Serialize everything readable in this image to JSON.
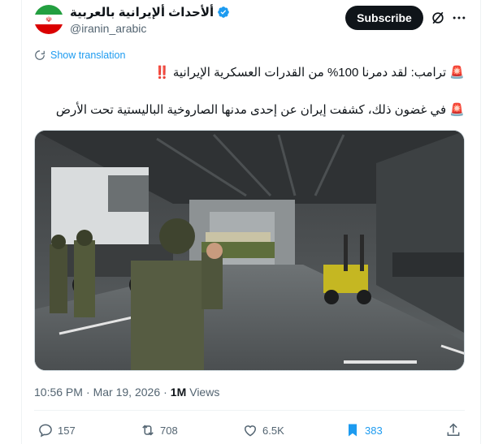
{
  "account": {
    "display_name": "ألأحداث ألإيرانية بالعربية",
    "handle": "@iranin_arabic",
    "verified": true,
    "avatar_icon": "iran-flag-avatar"
  },
  "header": {
    "subscribe_label": "Subscribe",
    "grok_icon": "grok-icon",
    "more_icon": "more-icon"
  },
  "translation": {
    "label": "Show translation",
    "icon": "translate-icon"
  },
  "tweet": {
    "line1": "🚨 ترامب: لقد دمرنا 100% من القدرات العسكرية الإيرانية ‼️",
    "line2": "🚨 في غضون ذلك، كشفت إيران عن إحدى مدنها الصاروخية الباليستية تحت الأرض"
  },
  "media": {
    "type": "video",
    "scene": "underground-missile-tunnel"
  },
  "meta": {
    "time": "10:56 PM",
    "separator": "·",
    "date": "Mar 19, 2026",
    "views_count": "1M",
    "views_label": "Views"
  },
  "actions": {
    "replies": "157",
    "reposts": "708",
    "likes": "6.5K",
    "bookmarks": "383"
  },
  "colors": {
    "accent": "#1d9bf0",
    "text": "#0f1419",
    "muted": "#536471",
    "border": "#eff3f4"
  }
}
